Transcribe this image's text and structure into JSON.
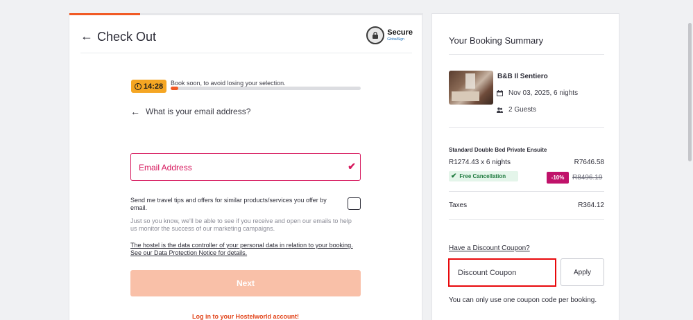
{
  "checkout": {
    "title": "Check Out",
    "secure_label": "Secure",
    "secure_sub": "GlobalSign",
    "timer": "14:28",
    "timer_message": "Book soon, to avoid losing your selection.",
    "timer_progress": 0.04,
    "email_question": "What is your email address?",
    "email_placeholder": "Email Address",
    "optin_text": "Send me travel tips and offers for similar products/services you offer by email.",
    "optin_note": "Just so you know, we'll be able to see if you receive and open our emails to help us monitor the success of our marketing campaigns.",
    "data_protection": "The hostel is the data controller of your personal data in relation to your booking. See our Data Protection Notice for details.",
    "next_label": "Next",
    "login_link": "Log in to your Hostelworld account!",
    "step_progress": 0.2
  },
  "summary": {
    "title": "Your Booking Summary",
    "property_name": "B&B Il Sentiero",
    "dates": "Nov 03, 2025, 6 nights",
    "guests": "2 Guests",
    "room_name": "Standard Double Bed Private Ensuite",
    "rate_line": "R1274.43 x 6 nights",
    "room_total": "R7646.58",
    "free_cancellation": "Free Cancellation",
    "discount": "-10%",
    "old_price": "R8496.19",
    "taxes_label": "Taxes",
    "taxes_value": "R364.12",
    "coupon_link": "Have a Discount Coupon?",
    "coupon_placeholder": "Discount Coupon",
    "apply_label": "Apply",
    "coupon_note": "You can only use one coupon code per booking."
  },
  "colors": {
    "accent": "#f15a24",
    "error": "#d6175c",
    "discount_badge": "#c0126a",
    "free_cancel_text": "#1f7a3f",
    "coupon_highlight": "#e8080b"
  }
}
